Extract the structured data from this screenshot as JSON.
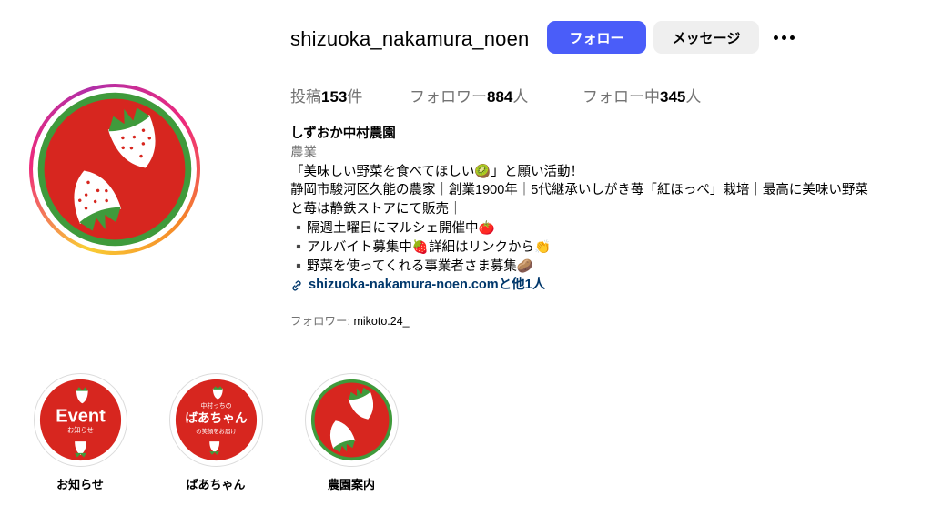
{
  "profile": {
    "username": "shizuoka_nakamura_noen",
    "follow_label": "フォロー",
    "message_label": "メッセージ",
    "more_icon": "more-horizontal-icon"
  },
  "stats": {
    "posts_label": "投稿",
    "posts_count": "153",
    "posts_unit": "件",
    "followers_label": "フォロワー",
    "followers_count": "884",
    "followers_unit": "人",
    "following_label": "フォロー中",
    "following_count": "345",
    "following_unit": "人"
  },
  "bio": {
    "name": "しずおか中村農園",
    "category": "農業",
    "lines": [
      "「美味しい野菜を食べてほしい🥝」と願い活動！",
      "静岡市駿河区久能の農家｜創業1900年｜5代継承いしがき苺「紅ほっぺ」栽培｜最高に美味い野菜",
      "と苺は静鉄ストアにて販売｜",
      "▪️隔週土曜日にマルシェ開催中🍅",
      "▪️アルバイト募集中🍓詳細はリンクから👏",
      "▪️野菜を使ってくれる事業者さま募集🥔"
    ],
    "link_text": "shizuoka-nakamura-noen.comと他1人",
    "link_icon": "link-icon",
    "followed_by_label": "フォロワー: ",
    "followed_by_user": "mikoto.24_"
  },
  "highlights": [
    {
      "label": "お知らせ",
      "cover_title": "Event",
      "cover_sub": "お知らせ"
    },
    {
      "label": "ばあちゃん",
      "cover_top": "中村っちの",
      "cover_title": "ばあちゃん",
      "cover_sub": "の笑顔をお届け"
    },
    {
      "label": "農園案内"
    }
  ],
  "colors": {
    "brand_red": "#d7261f",
    "leaf_green": "#3f9a3b",
    "follow_blue": "#4a5df9",
    "link_navy": "#00376b"
  }
}
